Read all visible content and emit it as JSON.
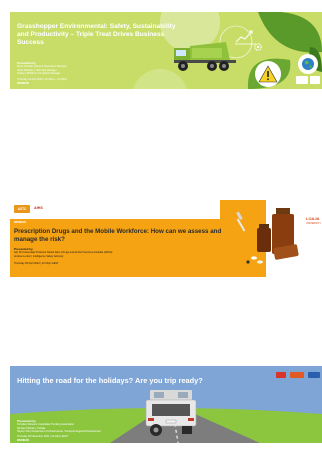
{
  "cards": [
    {
      "title": "Grasshopper Environmental: Safety, Sustainability and Productivity – Triple Treat Drives Business Success",
      "presenters_heading": "Presented by",
      "presenters": [
        "Byron McAllan | Fleet & Operations Manager",
        "Grant Marsden | Technical Manager",
        "Ashley | QHSE & Compliance Manager"
      ],
      "datetime": "Thursday 14 April 2022 | 12:15pm – 12:45pm",
      "tag": "WEBINAR",
      "colors": {
        "background": "#c8dd68",
        "accent": "#5a9a2a"
      }
    },
    {
      "header_logos": [
        "ASTC",
        "AfHS"
      ],
      "webinar_label": "WEBINAR",
      "title": "Prescription Drugs and the Mobile Workforce: How can we assess and manage the risk?",
      "presenters_heading": "Presented by",
      "presenters": [
        "Adj. Prof Associate Professor Daniel Allen | Drugs and Alcohol Services Australia (DASA)",
        "Andrew Lenton | Intelligence Safety Advisory"
      ],
      "datetime": "Thursday 28 April 2022 | 12:15pm AEST",
      "side_logo": "LOAJA",
      "side_note": "UNIVERSITY",
      "colors": {
        "background": "#f5a213",
        "header": "#ffffff"
      }
    },
    {
      "title": "Hitting the road for the holidays? Are you trip ready?",
      "presenters_heading": "Presented by",
      "presenters": [
        "Christian Manners | Australian Trucking Association",
        "Michael Kilbride | TruSafe",
        "Hayley Hall | Department of Infrastructure, Transport Regional Development"
      ],
      "datetime": "Thursday 18 November 2021 | 12:15pm AEST",
      "tag": "WEBINAR",
      "colors": {
        "sky": "#7fa4d6",
        "grass": "#8cc63f",
        "road": "#7d7d7d"
      }
    }
  ]
}
